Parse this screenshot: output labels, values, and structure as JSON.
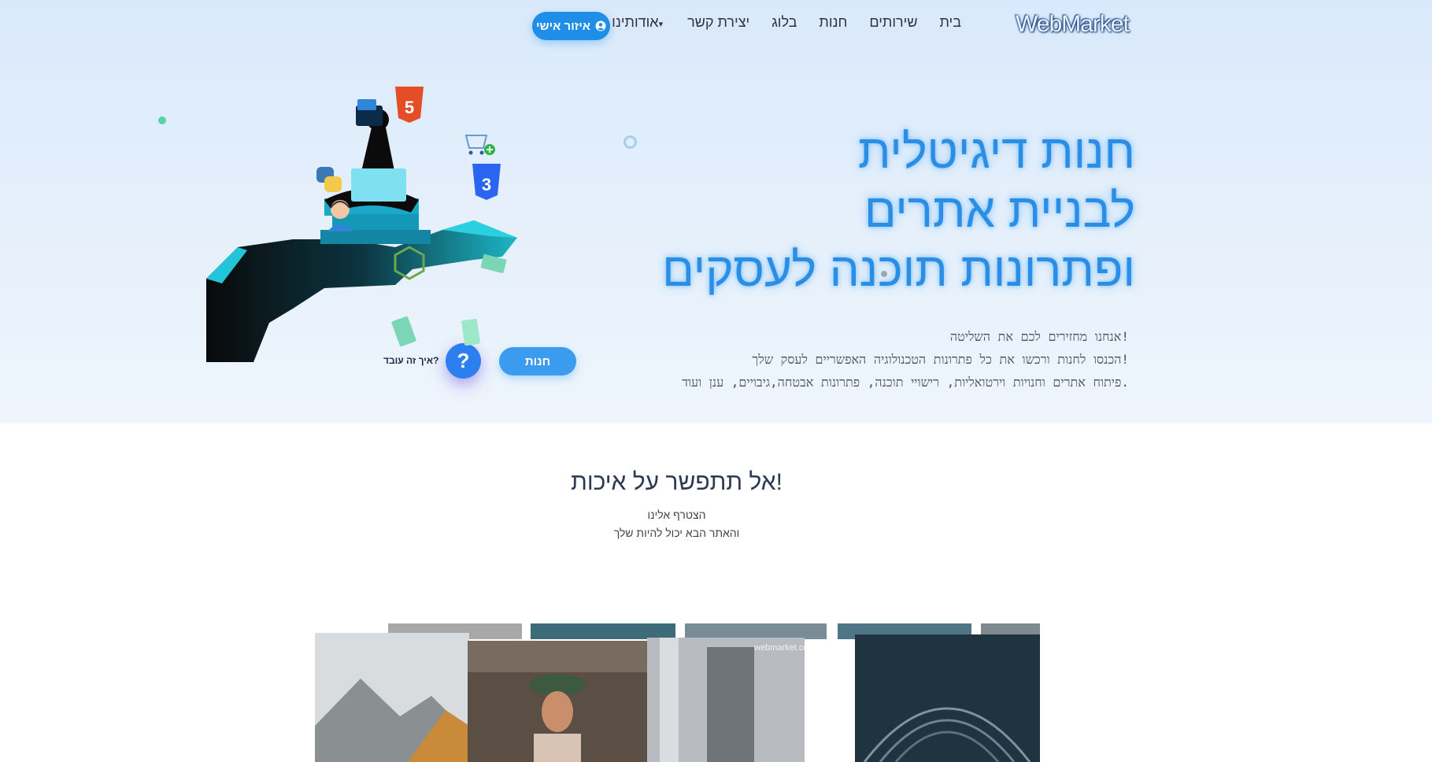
{
  "nav": {
    "logo": "WebMarket",
    "items": [
      "בית",
      "שירותים",
      "חנות",
      "בלוג",
      "יצירת קשר",
      "אודותינו"
    ],
    "account_button": "איזור אישי"
  },
  "hero": {
    "headline_lines": [
      "חנות דיגיטלית",
      "לבניית אתרים",
      "ופתרונות תוכנה לעסקים"
    ],
    "subtext_lines": [
      "אנחנו מחזירים לכם את השליטה!",
      "הכנסו לחנות ורכשו את כל פתרונות הטכנולוגיה האפשריים לעסק שלך!",
      "פיתוח אתרים וחנויות וירטואליות, רישויי תוכנה, פתרונות אבטחה,גיבויים, ענן ועוד."
    ],
    "shop_button": "חנות",
    "help_button": "?",
    "help_label": "איך זה עובד?"
  },
  "section": {
    "title": "אל תתפשר על איכות!",
    "subtitle_lines": [
      "הצטרף אלינו",
      "והאתר הבא יכול להיות שלך"
    ]
  },
  "gallery": {
    "watermark": "webmarket.com",
    "items": [
      "mountain-photo",
      "woman-hat-photo",
      "street-art-photo",
      "station-arch-photo"
    ]
  },
  "colors": {
    "accent": "#1f8ee8",
    "headline": "#2a8de6",
    "hero_bg": "#e2eefb",
    "section_title": "#2d3a52"
  },
  "icons": [
    "user-circle-icon",
    "caret-down-icon",
    "html5-icon",
    "css3-icon",
    "python-icon",
    "nodejs-icon",
    "cart-icon",
    "folder-icon",
    "support-agent-icon",
    "question-icon"
  ]
}
